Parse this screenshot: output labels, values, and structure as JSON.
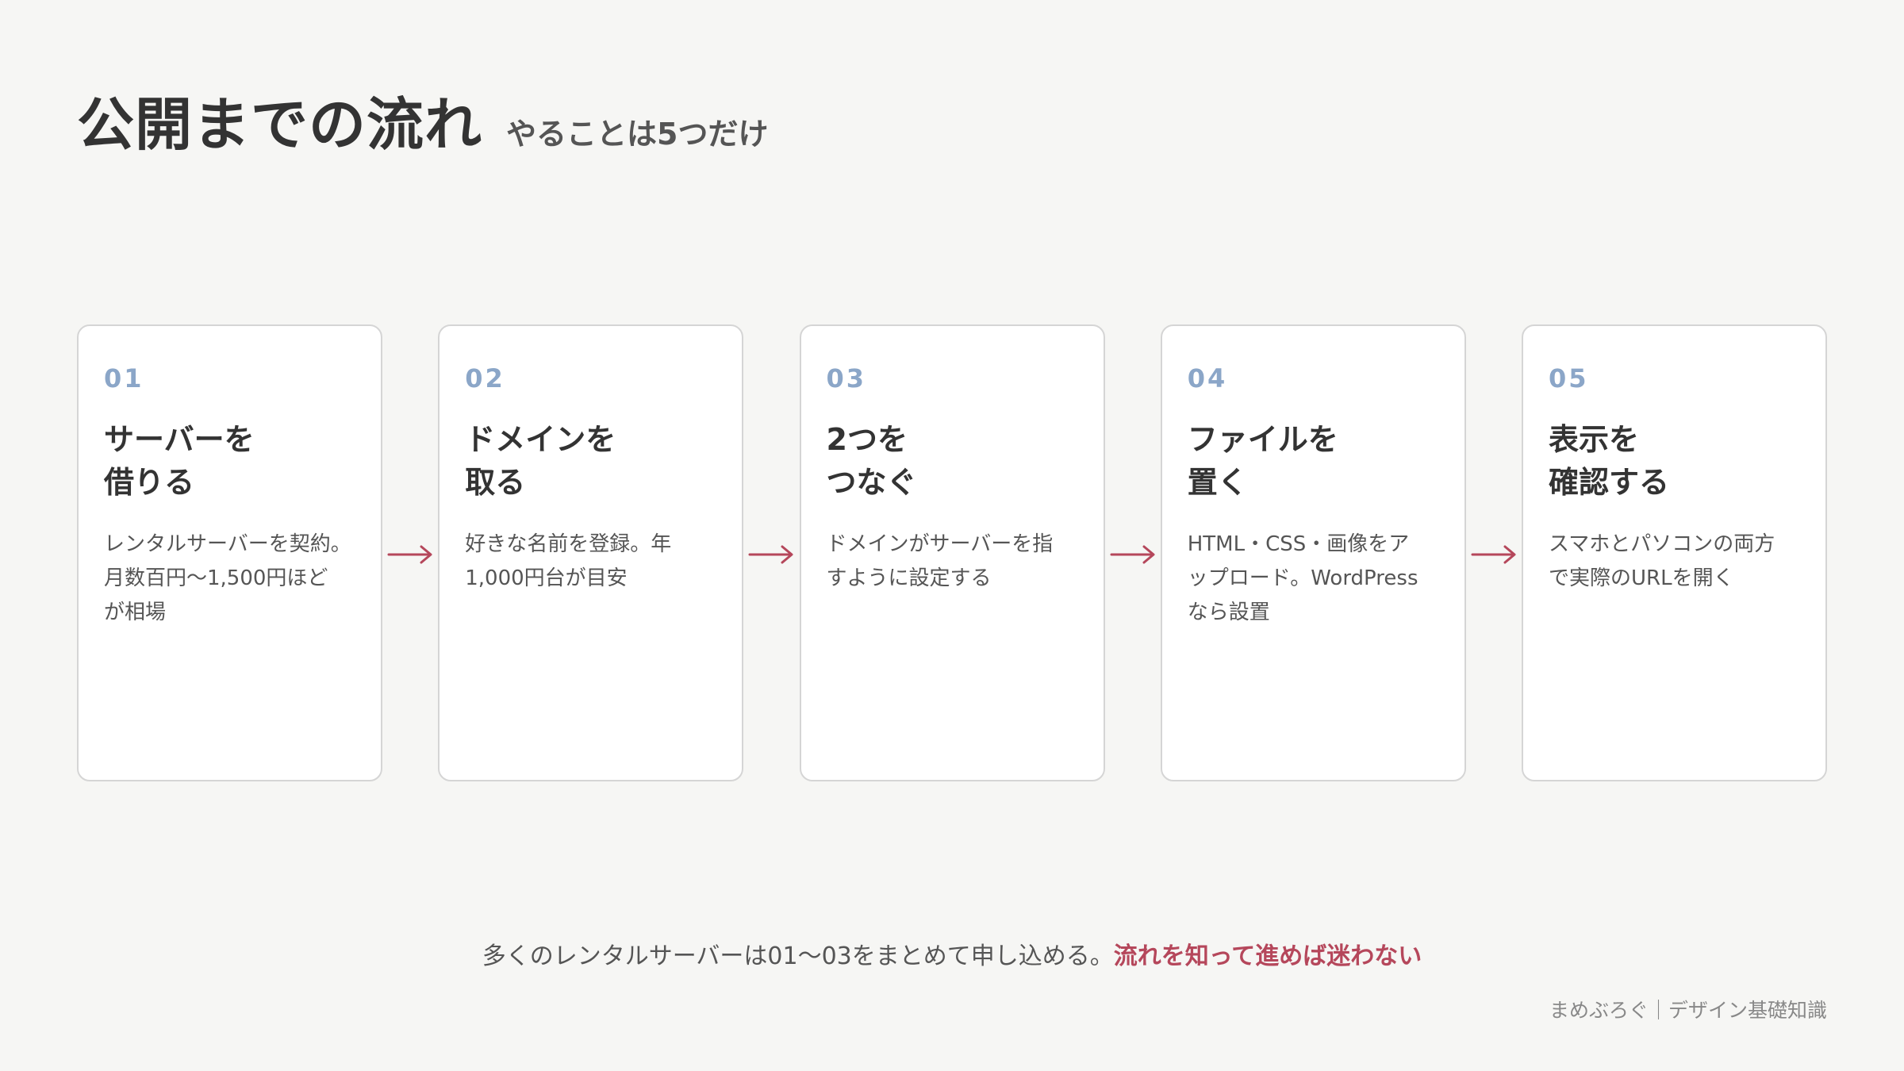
{
  "header": {
    "title": "公開までの流れ",
    "subtitle": "やることは5つだけ"
  },
  "steps": [
    {
      "number": "01",
      "title": "サーバーを\n借りる",
      "description": "レンタルサーバーを契約。\n月数百円〜1,500円ほど\nが相場"
    },
    {
      "number": "02",
      "title": "ドメインを\n取る",
      "description": "好きな名前を登録。年\n1,000円台が目安"
    },
    {
      "number": "03",
      "title": "2つを\nつなぐ",
      "description": "ドメインがサーバーを指\nすように設定する"
    },
    {
      "number": "04",
      "title": "ファイルを\n置く",
      "description": "HTML・CSS・画像をア\nップロード。WordPress\nなら設置"
    },
    {
      "number": "05",
      "title": "表示を\n確認する",
      "description": "スマホとパソコンの両方\nで実際のURLを開く"
    }
  ],
  "footer": {
    "note": "多くのレンタルサーバーは01〜03をまとめて申し込める。",
    "note_accent": "流れを知って進めば迷わない",
    "credit": "まめぶろぐ｜デザイン基礎知識"
  },
  "colors": {
    "background": "#f6f6f4",
    "accent": "#b5475b",
    "step_number": "#8ba6c8",
    "card_border": "#d5d5d5"
  },
  "icons": {
    "between_steps": "arrow-right-icon"
  }
}
